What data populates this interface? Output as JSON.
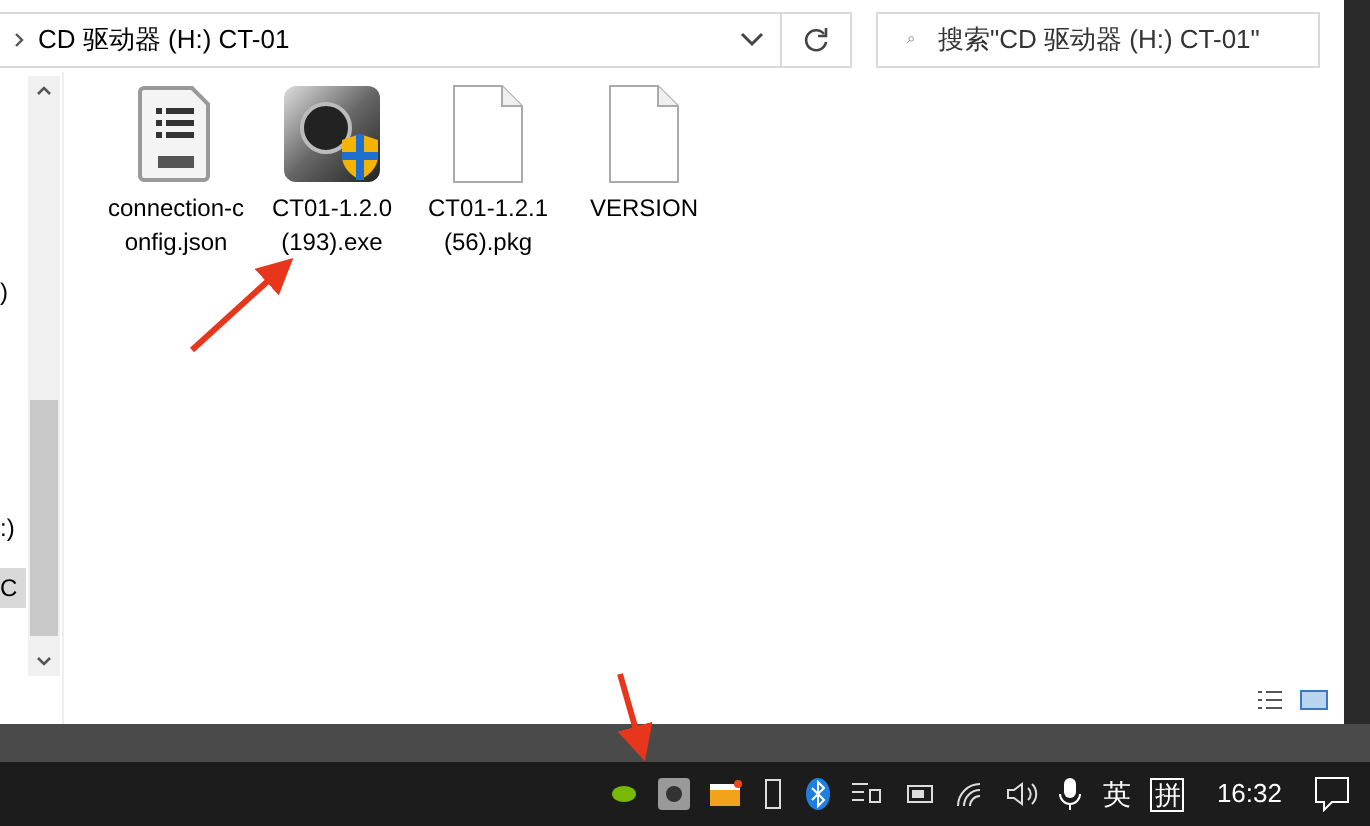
{
  "address_bar": {
    "path": "CD 驱动器 (H:) CT-01"
  },
  "search": {
    "placeholder": "搜索\"CD 驱动器 (H:) CT-01\""
  },
  "navigation": {
    "items": [
      {
        "label": ")",
        "selected": false
      },
      {
        "label": ":)",
        "selected": false
      },
      {
        "label": "C",
        "selected": true
      }
    ]
  },
  "files": [
    {
      "name": "connection-config.json",
      "kind": "json"
    },
    {
      "name": "CT01-1.2.0(193).exe",
      "kind": "exe"
    },
    {
      "name": "CT01-1.2.1(56).pkg",
      "kind": "file"
    },
    {
      "name": "VERSION",
      "kind": "file"
    }
  ],
  "taskbar": {
    "input_language": "英",
    "input_method": "拼",
    "time": "16:32"
  }
}
